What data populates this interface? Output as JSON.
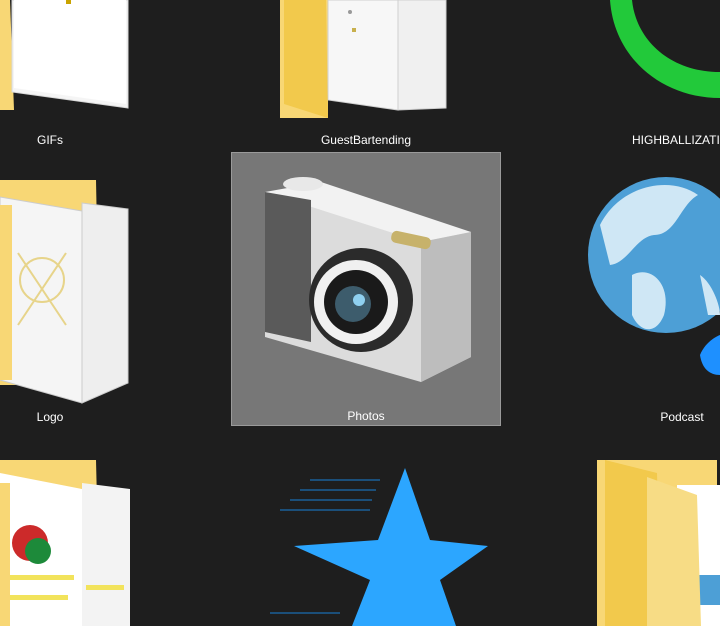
{
  "explorer": {
    "view": "extra-large-icons",
    "selected_item": "Photos",
    "items": [
      {
        "label": "GIFs",
        "icon": "folder-icon"
      },
      {
        "label": "GuestBartending",
        "icon": "folder-icon"
      },
      {
        "label": "HIGHBALLIZATIC",
        "icon": "green-ring-icon"
      },
      {
        "label": "Logo",
        "icon": "folder-icon"
      },
      {
        "label": "Photos",
        "icon": "camera-icon"
      },
      {
        "label": "Podcast",
        "icon": "globe-icon"
      },
      {
        "label": "",
        "icon": "folder-icon"
      },
      {
        "label": "",
        "icon": "star-icon"
      },
      {
        "label": "",
        "icon": "folder-icon"
      }
    ]
  },
  "colors": {
    "background": "#1e1e1e",
    "selection": "#777777",
    "folder": "#f8d775",
    "accent_blue": "#1e90ff",
    "green": "#22c93a"
  }
}
